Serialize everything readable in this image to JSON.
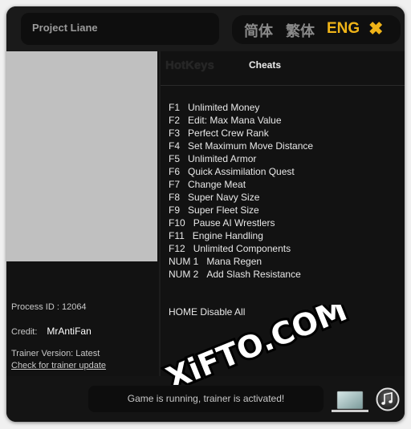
{
  "window": {
    "title": "Project Liane"
  },
  "languages": [
    {
      "label": "简体",
      "active": false
    },
    {
      "label": "繁体",
      "active": false
    },
    {
      "label": "ENG",
      "active": true
    }
  ],
  "colors": {
    "accent": "#f0b418",
    "background": "#141414",
    "text": "#e8e8e8"
  },
  "tabs": [
    {
      "label": "HotKeys"
    },
    {
      "label": "Cheats"
    }
  ],
  "cheats": [
    {
      "key": "F1",
      "label": "Unlimited Money"
    },
    {
      "key": "F2",
      "label": "Edit: Max Mana Value"
    },
    {
      "key": "F3",
      "label": "Perfect Crew Rank"
    },
    {
      "key": "F4",
      "label": "Set Maximum Move Distance"
    },
    {
      "key": "F5",
      "label": "Unlimited Armor"
    },
    {
      "key": "F6",
      "label": "Quick Assimilation Quest"
    },
    {
      "key": "F7",
      "label": "Change Meat"
    },
    {
      "key": "F8",
      "label": "Super Navy Size"
    },
    {
      "key": "F9",
      "label": "Super Fleet Size"
    },
    {
      "key": "F10",
      "label": "Pause AI Wrestlers"
    },
    {
      "key": "F11",
      "label": "Engine Handling"
    },
    {
      "key": "F12",
      "label": "Unlimited Components"
    },
    {
      "key": "NUM 1",
      "label": "Mana Regen"
    },
    {
      "key": "NUM 2",
      "label": "Add Slash Resistance"
    }
  ],
  "disable_all": "HOME Disable All",
  "info": {
    "process_id": "Process ID : 12064",
    "credit_label": "Credit:",
    "credit_value": "MrAntiFan",
    "version": "Trainer Version: Latest",
    "update_link": "Check for trainer update"
  },
  "status": "Game is running, trainer is activated!",
  "icons": {
    "close": "close-icon",
    "laptop": "laptop-icon",
    "music": "music-icon"
  },
  "watermark": "XiFTO.COM"
}
